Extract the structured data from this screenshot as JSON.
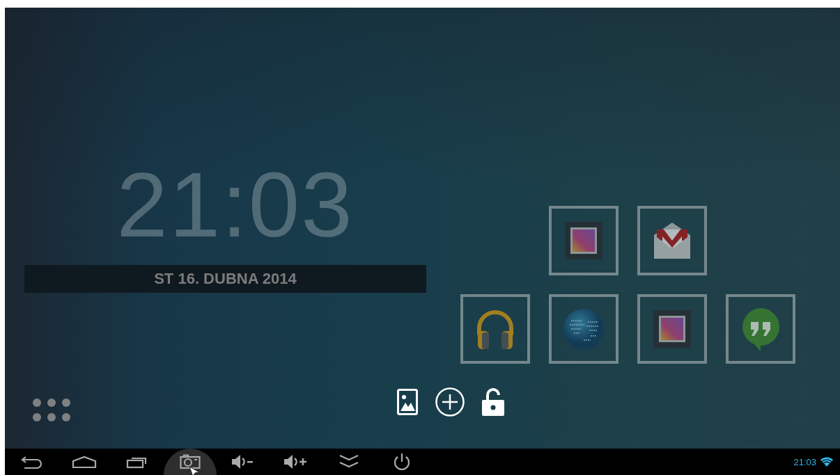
{
  "clock": {
    "time": "21:03",
    "date": "ST 16. DUBNA 2014"
  },
  "tile_rows": [
    {
      "tiles": [
        {
          "kind": "gallery"
        },
        {
          "kind": "mail"
        }
      ]
    },
    {
      "tiles": [
        {
          "kind": "music"
        },
        {
          "kind": "globe"
        },
        {
          "kind": "gallery"
        },
        {
          "kind": "chat"
        }
      ]
    }
  ],
  "home_actions": [
    {
      "kind": "wallpaper"
    },
    {
      "kind": "add"
    },
    {
      "kind": "unlock"
    }
  ],
  "nav_buttons": [
    {
      "kind": "back",
      "selected": false
    },
    {
      "kind": "home",
      "selected": false
    },
    {
      "kind": "recent",
      "selected": false
    },
    {
      "kind": "screenshot",
      "selected": true
    },
    {
      "kind": "volume_down",
      "selected": false
    },
    {
      "kind": "volume_up",
      "selected": false
    },
    {
      "kind": "collapse",
      "selected": false
    },
    {
      "kind": "power",
      "selected": false
    }
  ],
  "status_bar": {
    "time": "21:03"
  }
}
